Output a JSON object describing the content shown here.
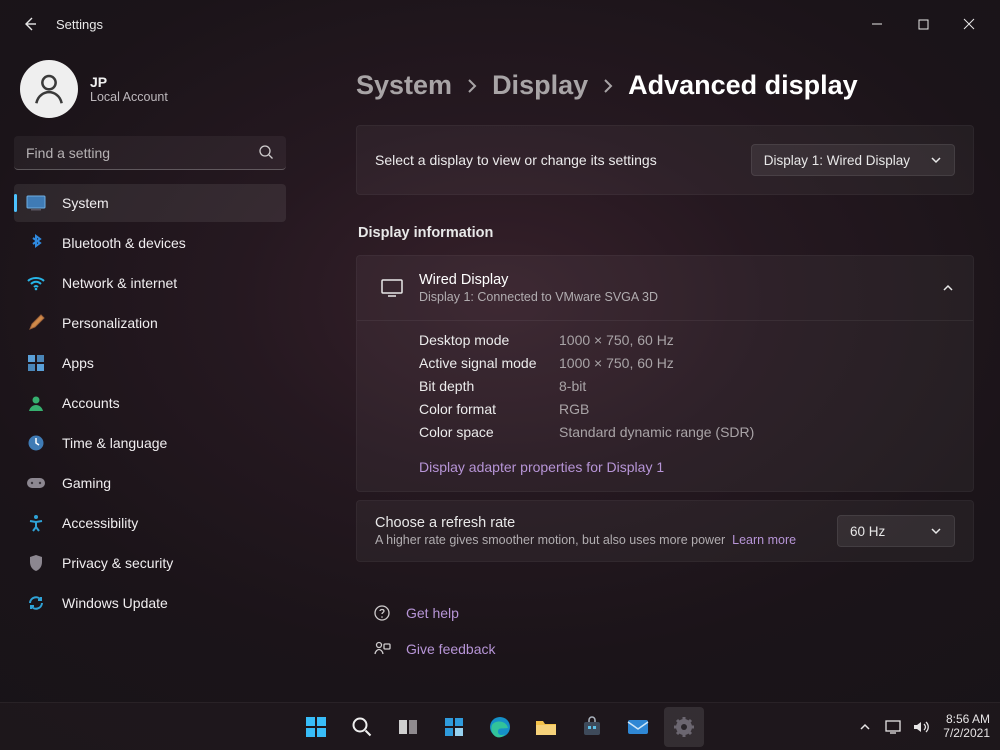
{
  "window": {
    "title": "Settings"
  },
  "user": {
    "initials": "JP",
    "subtitle": "Local Account"
  },
  "search": {
    "placeholder": "Find a setting"
  },
  "sidebar": {
    "items": [
      {
        "label": "System",
        "selected": true
      },
      {
        "label": "Bluetooth & devices"
      },
      {
        "label": "Network & internet"
      },
      {
        "label": "Personalization"
      },
      {
        "label": "Apps"
      },
      {
        "label": "Accounts"
      },
      {
        "label": "Time & language"
      },
      {
        "label": "Gaming"
      },
      {
        "label": "Accessibility"
      },
      {
        "label": "Privacy & security"
      },
      {
        "label": "Windows Update"
      }
    ]
  },
  "breadcrumb": {
    "part1": "System",
    "part2": "Display",
    "current": "Advanced display"
  },
  "select_display": {
    "label": "Select a display to view or change its settings",
    "value": "Display 1: Wired Display"
  },
  "section_title": "Display information",
  "display": {
    "name": "Wired Display",
    "sub": "Display 1: Connected to VMware SVGA 3D",
    "rows": [
      {
        "k": "Desktop mode",
        "v": "1000 × 750, 60 Hz"
      },
      {
        "k": "Active signal mode",
        "v": "1000 × 750, 60 Hz"
      },
      {
        "k": "Bit depth",
        "v": "8-bit"
      },
      {
        "k": "Color format",
        "v": "RGB"
      },
      {
        "k": "Color space",
        "v": "Standard dynamic range (SDR)"
      }
    ],
    "adapter_link": "Display adapter properties for Display 1"
  },
  "refresh": {
    "title": "Choose a refresh rate",
    "sub": "A higher rate gives smoother motion, but also uses more power",
    "learn_more": "Learn more",
    "value": "60 Hz"
  },
  "help": {
    "get_help": "Get help",
    "feedback": "Give feedback"
  },
  "tray": {
    "time": "8:56 AM",
    "date": "7/2/2021"
  }
}
